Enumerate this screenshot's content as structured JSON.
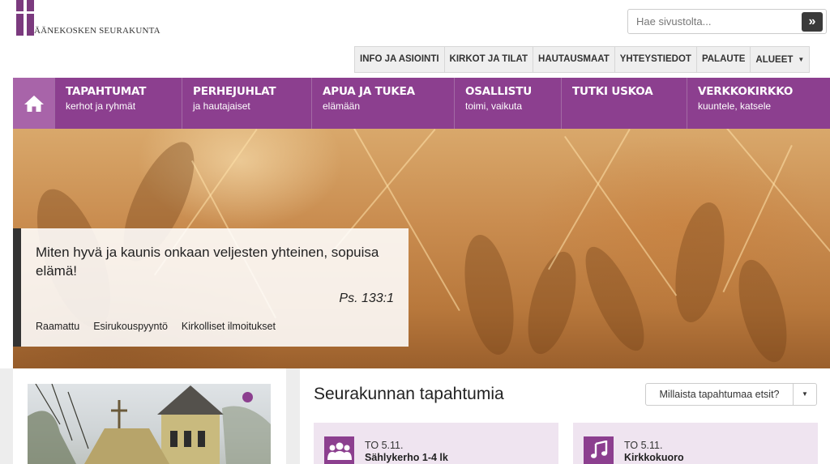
{
  "header": {
    "logo_text": "ÄÄNEKOSKEN SEURAKUNTA",
    "search_placeholder": "Hae sivustolta...",
    "search_button": "»"
  },
  "utility_nav": [
    {
      "label": "INFO JA ASIOINTI"
    },
    {
      "label": "KIRKOT JA TILAT"
    },
    {
      "label": "HAUTAUSMAAT"
    },
    {
      "label": "YHTEYSTIEDOT"
    },
    {
      "label": "PALAUTE"
    },
    {
      "label": "ALUEET"
    }
  ],
  "main_nav": [
    {
      "title": "TAPAHTUMAT",
      "subtitle": "kerhot ja ryhmät"
    },
    {
      "title": "PERHEJUHLAT",
      "subtitle": "ja hautajaiset"
    },
    {
      "title": "APUA JA TUKEA",
      "subtitle": "elämään"
    },
    {
      "title": "OSALLISTU",
      "subtitle": "toimi, vaikuta"
    },
    {
      "title": "TUTKI USKOA",
      "subtitle": ""
    },
    {
      "title": "VERKKOKIRKKO",
      "subtitle": "kuuntele, katsele"
    }
  ],
  "hero": {
    "quote": "Miten hyvä ja kaunis onkaan veljesten yhteinen, sopuisa elämä!",
    "reference": "Ps. 133:1",
    "links": [
      "Raamattu",
      "Esirukouspyyntö",
      "Kirkolliset ilmoitukset"
    ]
  },
  "events": {
    "title": "Seurakunnan tapahtumia",
    "filter_label": "Millaista tapahtumaa etsit?",
    "items": [
      {
        "date": "TO 5.11.",
        "name": "Sählykerho 1-4 lk",
        "icon": "group-icon"
      },
      {
        "date": "TO 5.11.",
        "name": "Kirkkokuoro",
        "icon": "music-note-icon"
      }
    ]
  },
  "colors": {
    "brand_purple": "#8c3f8f",
    "home_purple": "#a864a9"
  }
}
